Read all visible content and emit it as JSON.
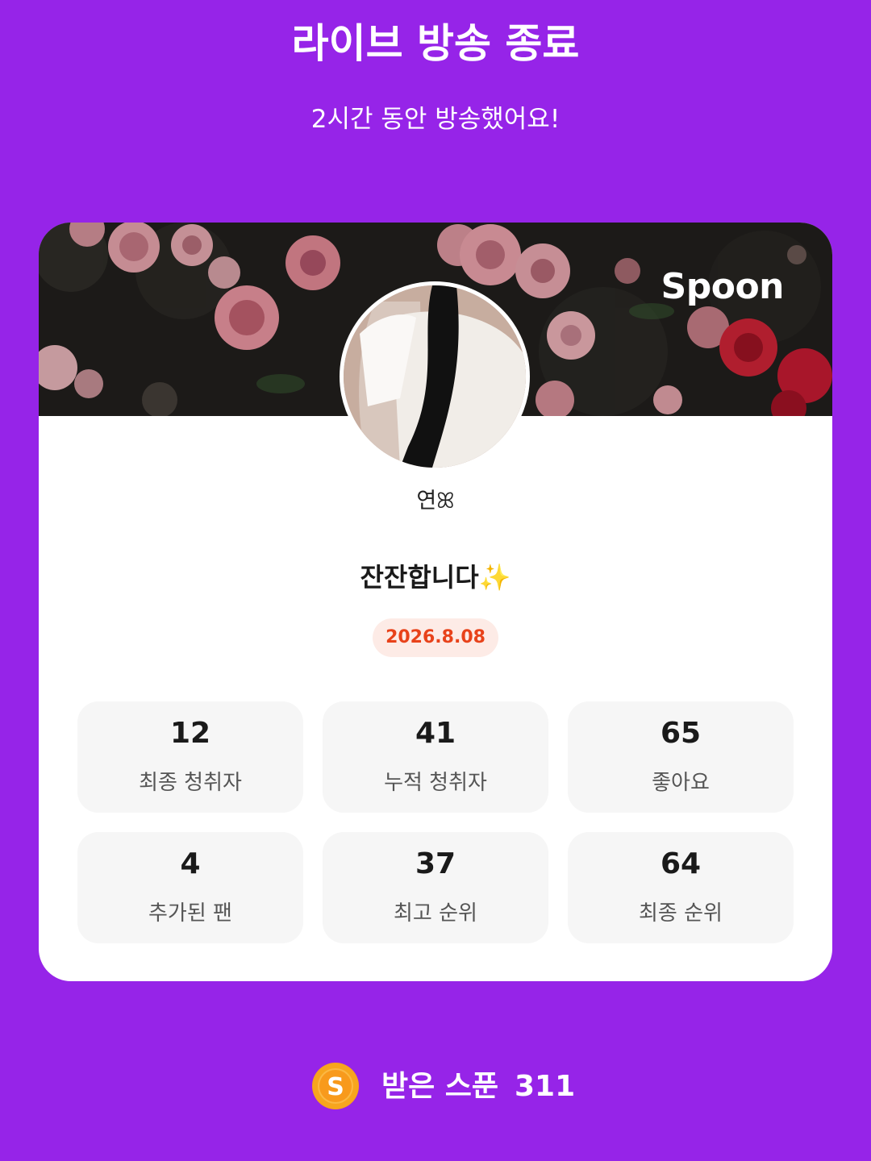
{
  "header": {
    "title": "라이브 방송 종료",
    "subtitle": "2시간 동안 방송했어요!"
  },
  "card": {
    "brand": "Spoon",
    "nickname": "연ꕤ",
    "broadcast_title": "잔잔합니다✨",
    "date": "2026.8.08",
    "stats": [
      {
        "value": "12",
        "label": "최종 청취자"
      },
      {
        "value": "41",
        "label": "누적 청취자"
      },
      {
        "value": "65",
        "label": "좋아요"
      },
      {
        "value": "4",
        "label": "추가된 팬"
      },
      {
        "value": "37",
        "label": "최고 순위"
      },
      {
        "value": "64",
        "label": "최종 순위"
      }
    ]
  },
  "footer": {
    "spoon_label": "받은 스푼",
    "spoon_count": "311",
    "coin_letter": "S"
  },
  "colors": {
    "background": "#9624e8",
    "date_text": "#e8421a",
    "date_badge": "#fdebe6",
    "coin": "#f9a21a"
  }
}
